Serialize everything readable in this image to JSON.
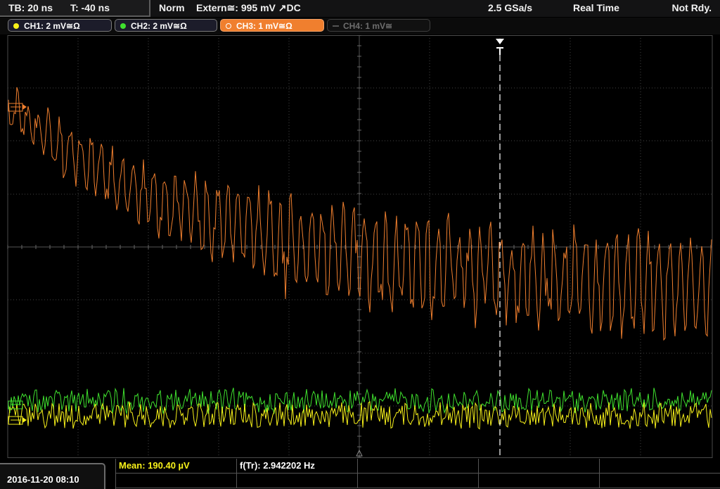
{
  "status_bar": {
    "timebase": "TB: 20 ns",
    "trigger_time": "T: -40 ns",
    "trigger_mode": "Norm",
    "trigger_source": "Extern≅: 995 mV ↗DC",
    "sample_rate": "2.5 GSa/s",
    "acquisition_mode": "Real Time",
    "status": "Not Rdy."
  },
  "channels": [
    {
      "label": "CH1: 2 mV≅Ω",
      "color": "#f7f11a",
      "active": false
    },
    {
      "label": "CH2: 2 mV≅Ω",
      "color": "#3fe02e",
      "active": false
    },
    {
      "label": "CH3: 1 mV≅Ω",
      "color": "#f07f2e",
      "active": true
    },
    {
      "label": "CH4: 1 mV≅",
      "color": "#6e6e6e",
      "active": false
    }
  ],
  "colors": {
    "ch1": "#f7f11a",
    "ch2": "#3fe02e",
    "ch3": "#f07f2e",
    "grid": "#444444",
    "trigger_marker": "#ffffff"
  },
  "icons": {
    "trigger_position": "trigger-t-marker-icon",
    "ch3_ground": "ch3-offset-marker-icon",
    "ch1_ground": "ch1-offset-marker-icon",
    "ch2_ground": "ch2-offset-marker-icon",
    "center_marker": "center-triangle-icon"
  },
  "measurements": {
    "mean": "Mean: 190.40 µV",
    "frequency": "f(Tr): 2.942202 Hz"
  },
  "datetime": "2016-11-20 08:10"
}
